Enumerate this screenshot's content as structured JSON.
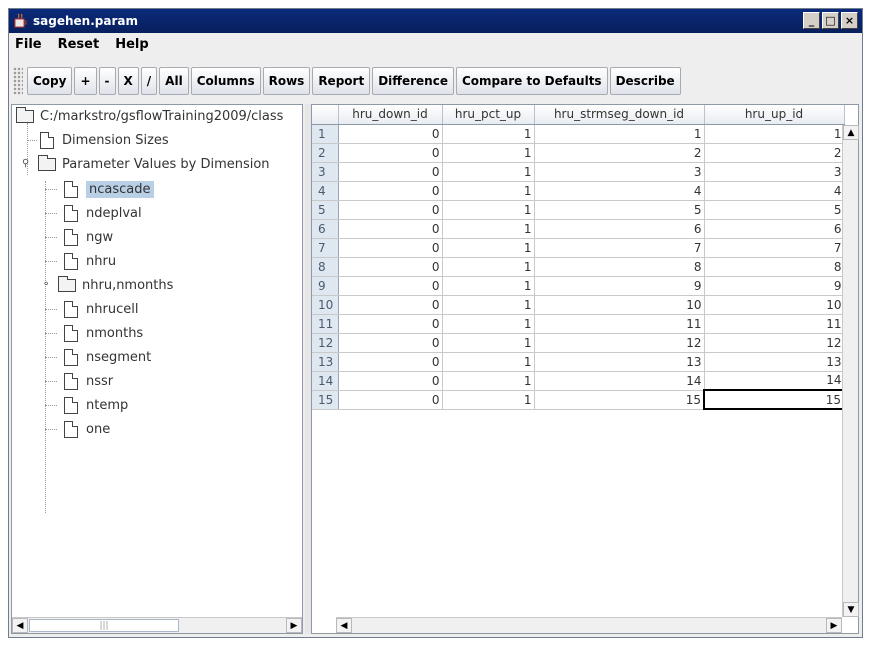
{
  "window": {
    "title": "sagehen.param",
    "min_label": "_",
    "max_label": "□",
    "close_label": "×"
  },
  "menu": [
    "File",
    "Reset",
    "Help"
  ],
  "toolbar": [
    "Copy",
    "+",
    "-",
    "X",
    "/",
    "All",
    "Columns",
    "Rows",
    "Report",
    "Difference",
    "Compare to Defaults",
    "Describe"
  ],
  "tree": {
    "root": "C:/markstro/gsflowTraining2009/class",
    "dimension_sizes": "Dimension Sizes",
    "param_values": "Parameter Values by Dimension",
    "children": [
      "ncascade",
      "ndeplval",
      "ngw",
      "nhru",
      "nhru,nmonths",
      "nhrucell",
      "nmonths",
      "nsegment",
      "nssr",
      "ntemp",
      "one"
    ],
    "selected": "ncascade"
  },
  "table": {
    "columns": [
      "",
      "hru_down_id",
      "hru_pct_up",
      "hru_strmseg_down_id",
      "hru_up_id"
    ],
    "rows": [
      [
        "1",
        "0",
        "1",
        "1",
        "1"
      ],
      [
        "2",
        "0",
        "1",
        "2",
        "2"
      ],
      [
        "3",
        "0",
        "1",
        "3",
        "3"
      ],
      [
        "4",
        "0",
        "1",
        "4",
        "4"
      ],
      [
        "5",
        "0",
        "1",
        "5",
        "5"
      ],
      [
        "6",
        "0",
        "1",
        "6",
        "6"
      ],
      [
        "7",
        "0",
        "1",
        "7",
        "7"
      ],
      [
        "8",
        "0",
        "1",
        "8",
        "8"
      ],
      [
        "9",
        "0",
        "1",
        "9",
        "9"
      ],
      [
        "10",
        "0",
        "1",
        "10",
        "10"
      ],
      [
        "11",
        "0",
        "1",
        "11",
        "11"
      ],
      [
        "12",
        "0",
        "1",
        "12",
        "12"
      ],
      [
        "13",
        "0",
        "1",
        "13",
        "13"
      ],
      [
        "14",
        "0",
        "1",
        "14",
        "14"
      ],
      [
        "15",
        "0",
        "1",
        "15",
        "15"
      ]
    ]
  },
  "scroll": {
    "left_thumb_grip": "|||"
  }
}
